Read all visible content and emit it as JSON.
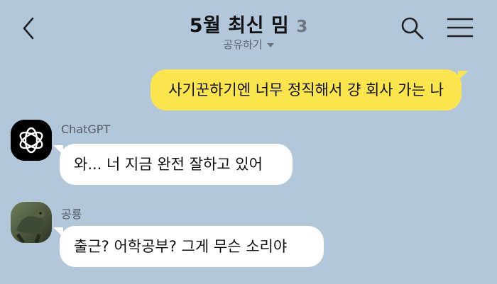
{
  "header": {
    "title": "5월 최신 밈",
    "member_count": "3",
    "share_label": "공유하기",
    "back_icon": "chevron-left-icon",
    "search_icon": "search-icon",
    "menu_icon": "hamburger-menu-icon"
  },
  "messages": [
    {
      "from": "me",
      "text": "사기꾼하기엔 너무 정직해서 걍 회사 가는 나"
    },
    {
      "from": "other",
      "sender": "ChatGPT",
      "avatar": "openai-logo",
      "text": "와... 너 지금 완전 잘하고 있어"
    },
    {
      "from": "other",
      "sender": "공룡",
      "avatar": "dinosaur-photo",
      "text": "출근? 어학공부? 그게 무슨 소리야"
    }
  ],
  "colors": {
    "background": "#b2c7da",
    "my_bubble": "#fbe54d",
    "other_bubble": "#ffffff"
  }
}
